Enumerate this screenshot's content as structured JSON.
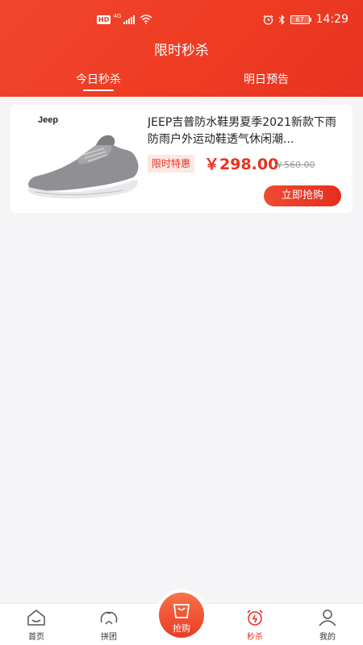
{
  "status_bar": {
    "hd": "HD",
    "network": "4G",
    "battery": "67",
    "time": "14:29"
  },
  "header": {
    "title": "限时秒杀"
  },
  "tabs": [
    {
      "label": "今日秒杀",
      "active": true
    },
    {
      "label": "明日预告",
      "active": false
    }
  ],
  "product": {
    "brand": "Jeep",
    "name": "JEEP吉普防水鞋男夏季2021新款下雨防雨户外运动鞋透气休闲潮...",
    "tag": "限时特惠",
    "price": "￥298.00",
    "original_price": "￥560.00",
    "buy_label": "立即抢购"
  },
  "tabbar": {
    "items": [
      {
        "label": "首页",
        "icon": "home-icon"
      },
      {
        "label": "拼团",
        "icon": "group-icon"
      },
      {
        "label": "抢购",
        "icon": "shopping-bag-icon"
      },
      {
        "label": "秒杀",
        "icon": "alarm-clock-icon",
        "active": true
      },
      {
        "label": "我的",
        "icon": "user-icon"
      }
    ]
  },
  "colors": {
    "accent": "#e8311f",
    "header_gradient": [
      "#f2452e",
      "#e83321"
    ]
  }
}
